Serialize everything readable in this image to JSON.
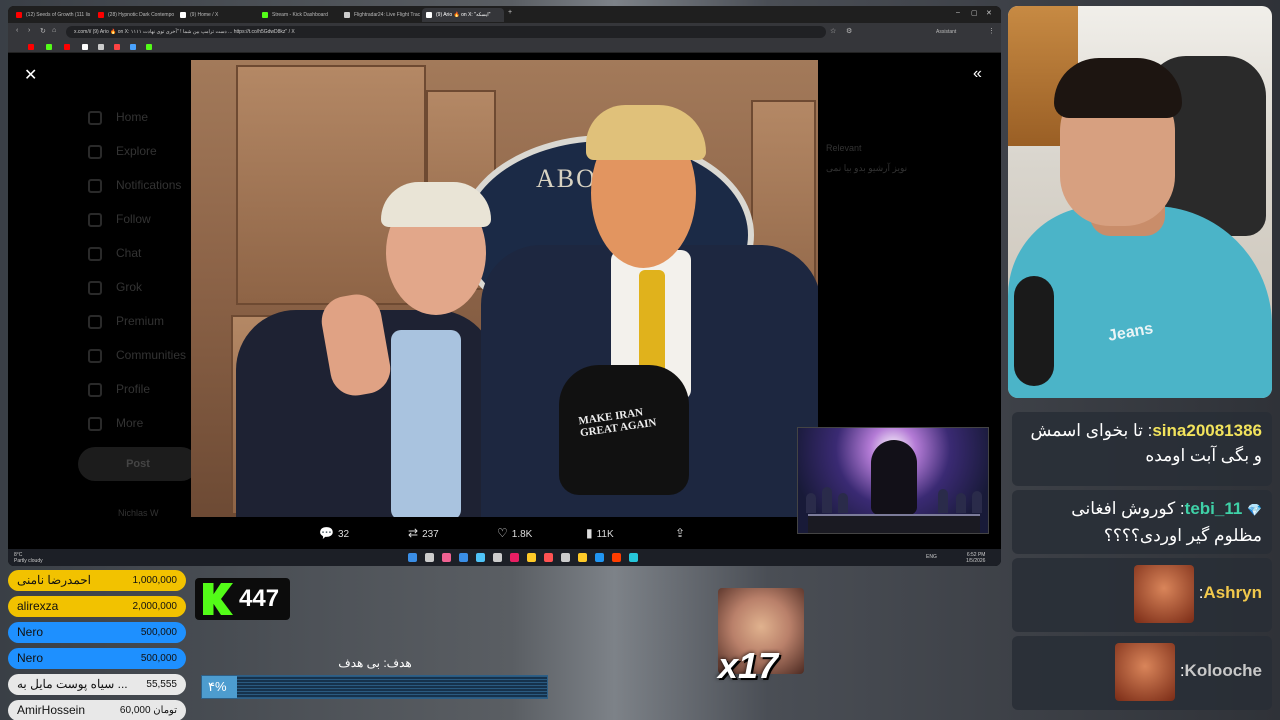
{
  "browser": {
    "tabs": [
      {
        "label": "(12) Seeds of Growth (111 lis",
        "color": "#ff0000",
        "active": false
      },
      {
        "label": "(28) Hypnotic Dark Contempo",
        "color": "#ff0000",
        "active": false
      },
      {
        "label": "(9) Home / X",
        "color": "#ffffff",
        "active": false
      },
      {
        "label": "Stream - Kick Dashboard",
        "color": "#53fc18",
        "active": false
      },
      {
        "label": "Flightradar24: Live Flight Trac",
        "color": "#cccccc",
        "active": false
      },
      {
        "label": "(9) Ario 🔥 on X: \"ایسکه\"",
        "color": "#ffffff",
        "active": true
      }
    ],
    "new_tab": "+",
    "window_controls": [
      "–",
      "▢",
      "✕"
    ],
    "address": "x.com/i/ (9) Ario 🔥 on X: ۱۱۱۱ دست ترامپ بین شما ! \"آخری توی نهادت ... https://t.co/h5GdwD8kz\" / X",
    "assistant_label": "Assistant",
    "bookmark_colors": [
      "#ff0000",
      "#53fc18",
      "#ff0000",
      "#ffffff",
      "#cccccc",
      "#ff4444",
      "#4aa3ff",
      "#53fc18"
    ]
  },
  "x_page": {
    "nav": [
      "Home",
      "Explore",
      "Notifications",
      "Follow",
      "Chat",
      "Grok",
      "Premium",
      "Communities",
      "Profile",
      "More"
    ],
    "post_button": "Post",
    "user_handle": "Nichlas W",
    "right_dim": [
      "Relevant",
      "نویز آرشیو بدو بیا نمی"
    ],
    "close_icon": "✕",
    "collapse_icon": "«",
    "photo": {
      "seal_text": "ABO",
      "hat_text_line1": "MAKE IRAN",
      "hat_text_line2": "GREAT AGAIN"
    },
    "actions": {
      "replies": "32",
      "reposts": "237",
      "likes": "1.8K",
      "views": "11K"
    }
  },
  "taskbar": {
    "weather_temp": "8°C",
    "weather_desc": "Partly cloudy",
    "tray": "ENG",
    "time": "6:52 PM",
    "date": "1/5/2026",
    "icon_colors": [
      "#3a8ee6",
      "#cccccc",
      "#f06292",
      "#3a8ee6",
      "#4fc3f7",
      "#cccccc",
      "#e91e63",
      "#ffca28",
      "#ff5252",
      "#cccccc",
      "#ffca28",
      "#2196f3",
      "#ff3d00",
      "#26c6da"
    ]
  },
  "donations": [
    {
      "name": "احمدرضا نامنی",
      "amount": "1,000,000",
      "color": "#f2c200"
    },
    {
      "name": "alirexza",
      "amount": "2,000,000",
      "color": "#f2c200"
    },
    {
      "name": "Nero",
      "amount": "500,000",
      "color": "#1e90ff"
    },
    {
      "name": "Nero",
      "amount": "500,000",
      "color": "#1e90ff"
    },
    {
      "name": "سیاه پوست مایل به ...",
      "amount": "55,555",
      "color": "#e8e8e8"
    },
    {
      "name": "AmirHossein",
      "amount": "60,000 تومان",
      "color": "#e8e8e8"
    }
  ],
  "kick": {
    "count": "447",
    "logo_color": "#53fc18"
  },
  "goal": {
    "label": "هدف: بی هدف",
    "percent_text": "۴%",
    "progress": 0.04
  },
  "combo": {
    "text": "x17"
  },
  "chat": [
    {
      "user": "sina20081386",
      "user_color": "#f2e35c",
      "text": "تا بخوای اسمش و بگی آبت اومده",
      "badge": ""
    },
    {
      "user": "tebi_11",
      "user_color": "#3fd1a7",
      "text": "کوروش افغانی مظلوم گیر اوردی؟؟؟؟",
      "badge": "💎"
    },
    {
      "user": "Ashryn",
      "user_color": "#f2c94c",
      "text": "",
      "badge": ""
    },
    {
      "user": "Kolooche",
      "user_color": "#c9c9c9",
      "text": "",
      "badge": ""
    }
  ],
  "webcam": {
    "shirt_text": "Jeans"
  }
}
